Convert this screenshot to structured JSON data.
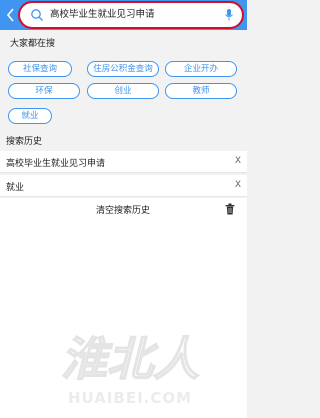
{
  "search": {
    "query": "高校毕业生就业见习申请"
  },
  "popular": {
    "title": "大家都在搜",
    "tags": [
      "社保查询",
      "住房公积金查询",
      "企业开办",
      "环保",
      "创业",
      "教师",
      "就业"
    ]
  },
  "history": {
    "title": "搜索历史",
    "items": [
      {
        "text": "高校毕业生就业见习申请",
        "delete": "X"
      },
      {
        "text": "就业",
        "delete": "X"
      }
    ],
    "clear_label": "清空搜索历史"
  },
  "watermark": {
    "text": "淮北人",
    "url": "HUAIBEI.COM"
  },
  "colors": {
    "header": "#3f95f0",
    "accent": "#3f95f0",
    "highlight_border": "#d0112b"
  }
}
